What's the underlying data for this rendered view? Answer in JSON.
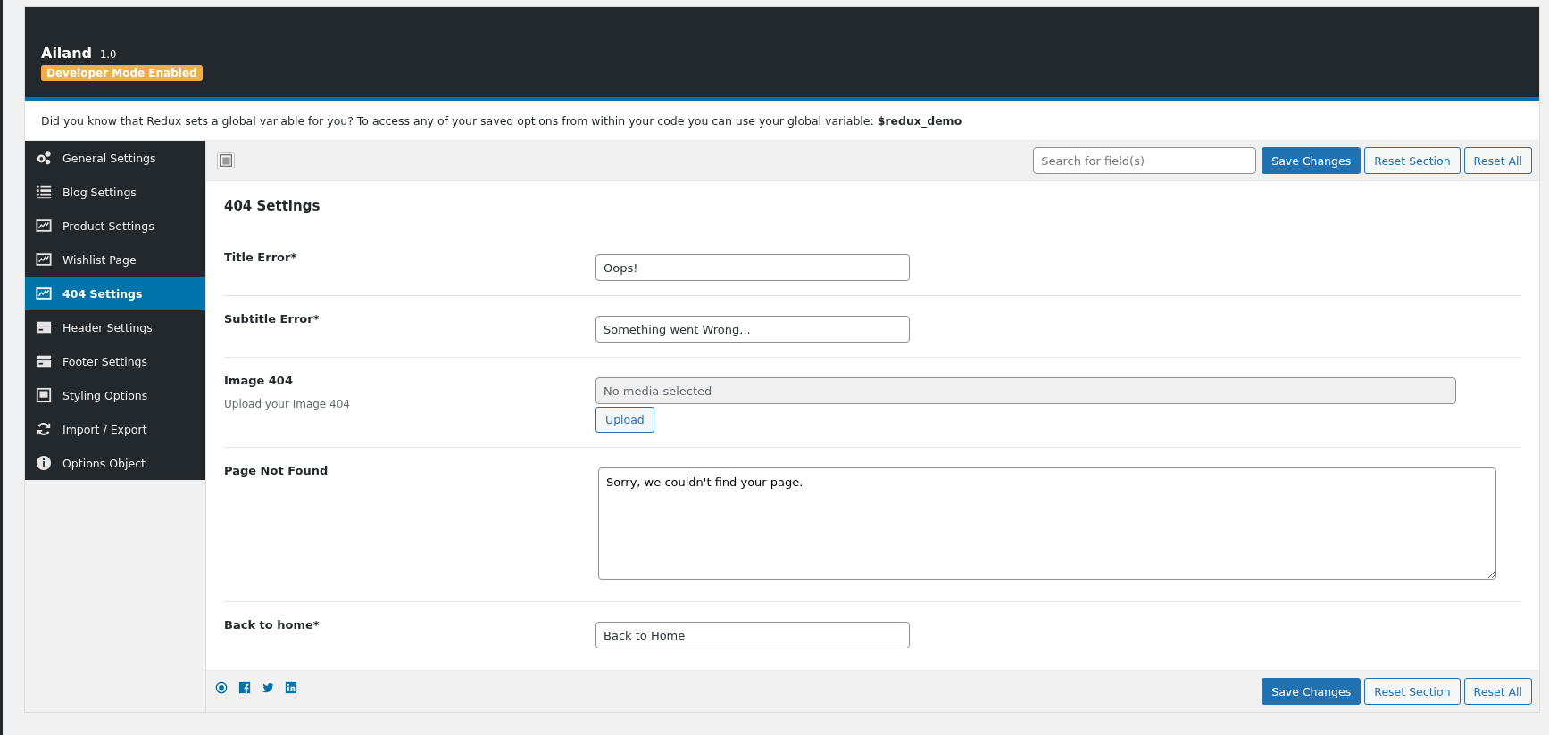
{
  "header": {
    "title": "Ailand",
    "version": "1.0",
    "badge": "Developer Mode Enabled"
  },
  "notice": {
    "text": "Did you know that Redux sets a global variable for you? To access any of your saved options from within your code you can use your global variable: **$redux_demo**"
  },
  "sidebar": {
    "items": [
      {
        "label": "General Settings",
        "selected": false
      },
      {
        "label": "Blog Settings",
        "selected": false
      },
      {
        "label": "Product Settings",
        "selected": false
      },
      {
        "label": "Wishlist Page",
        "selected": false
      },
      {
        "label": "404 Settings",
        "selected": true
      },
      {
        "label": "Header Settings",
        "selected": false
      },
      {
        "label": "Footer Settings",
        "selected": false
      },
      {
        "label": "Styling Options",
        "selected": false
      },
      {
        "label": "Import / Export",
        "selected": false
      },
      {
        "label": "Options Object",
        "selected": false
      }
    ]
  },
  "toolbar": {
    "search_placeholder": "Search for field(s)",
    "buttons": [
      "Save Changes",
      "Reset Section",
      "Reset All"
    ]
  },
  "section": {
    "title": "404 Settings",
    "fields": [
      {
        "kind": "text",
        "label": "Title Error*",
        "value": "Oops!"
      },
      {
        "kind": "text",
        "label": "Subtitle Error*",
        "value": "Something went Wrong..."
      },
      {
        "kind": "media",
        "label": "Image 404",
        "description": "Upload your Image 404",
        "placeholder": "No media selected",
        "button": "Upload"
      },
      {
        "kind": "textarea",
        "label": "Page Not Found",
        "value": "Sorry, we couldn't find your page."
      },
      {
        "kind": "text",
        "label": "Back to home*",
        "value": "Back to Home"
      }
    ]
  },
  "footer": {
    "buttons": [
      "Save Changes",
      "Reset Section",
      "Reset All"
    ]
  }
}
